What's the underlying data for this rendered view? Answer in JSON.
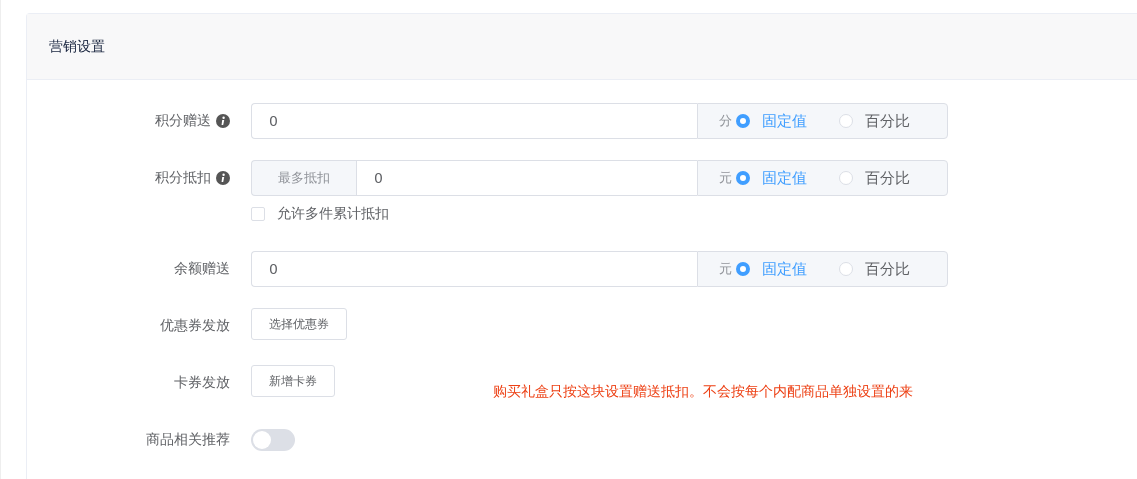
{
  "card": {
    "title": "营销设置"
  },
  "fields": [
    {
      "kind": "input-radio",
      "label": "积分赠送",
      "info": true,
      "value": "0",
      "unit": "分",
      "options": [
        {
          "label": "固定值",
          "selected": true
        },
        {
          "label": "百分比",
          "selected": false
        }
      ]
    },
    {
      "kind": "input-radio",
      "label": "积分抵扣",
      "info": true,
      "prefix": "最多抵扣",
      "value": "0",
      "unit": "元",
      "options": [
        {
          "label": "固定值",
          "selected": true
        },
        {
          "label": "百分比",
          "selected": false
        }
      ],
      "checkbox": {
        "label": "允许多件累计抵扣",
        "checked": false
      }
    },
    {
      "kind": "input-radio",
      "label": "余额赠送",
      "info": false,
      "value": "0",
      "unit": "元",
      "options": [
        {
          "label": "固定值",
          "selected": true
        },
        {
          "label": "百分比",
          "selected": false
        }
      ]
    },
    {
      "kind": "button",
      "label": "优惠券发放",
      "button": "选择优惠券"
    },
    {
      "kind": "button",
      "label": "卡券发放",
      "button": "新增卡券",
      "note": "购买礼盒只按这块设置赠送抵扣。不会按每个内配商品单独设置的来"
    },
    {
      "kind": "switch",
      "label": "商品相关推荐",
      "on": false
    }
  ]
}
